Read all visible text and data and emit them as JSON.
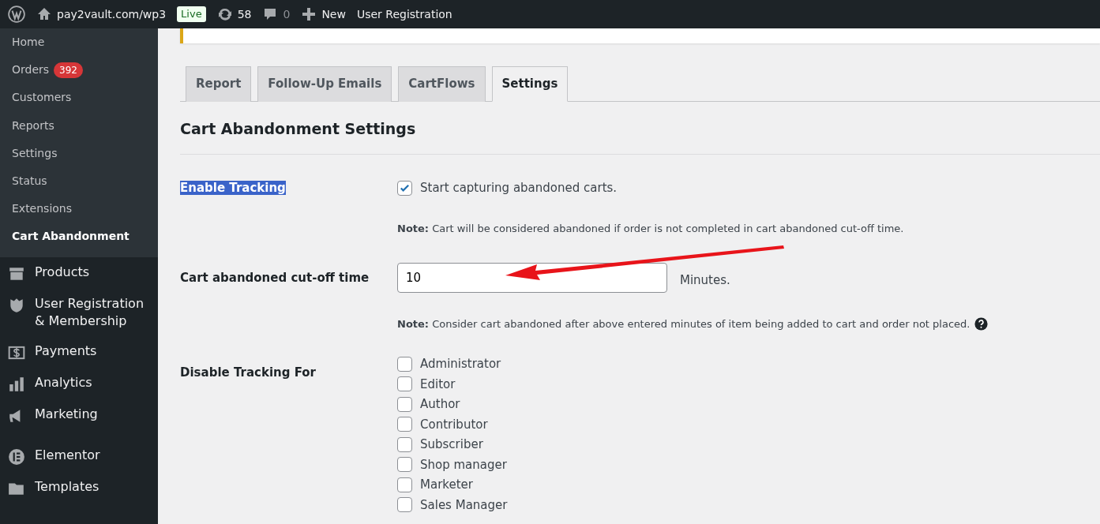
{
  "admin_bar": {
    "site": "pay2vault.com/wp3",
    "badge": "Live",
    "updates": "58",
    "comments": "0",
    "new": "New",
    "extra": "User Registration"
  },
  "sidebar": {
    "submenu": [
      {
        "label": "Home",
        "selected": false
      },
      {
        "label": "Orders",
        "badge": "392",
        "selected": false
      },
      {
        "label": "Customers",
        "selected": false
      },
      {
        "label": "Reports",
        "selected": false
      },
      {
        "label": "Settings",
        "selected": false
      },
      {
        "label": "Status",
        "selected": false
      },
      {
        "label": "Extensions",
        "selected": false
      },
      {
        "label": "Cart Abandonment",
        "selected": true
      }
    ],
    "menu": [
      {
        "label": "Products"
      },
      {
        "label": "User Registration & Membership"
      },
      {
        "label": "Payments"
      },
      {
        "label": "Analytics"
      },
      {
        "label": "Marketing"
      },
      {
        "label": "Elementor"
      },
      {
        "label": "Templates"
      }
    ]
  },
  "tabs": [
    {
      "label": "Report",
      "selected": false
    },
    {
      "label": "Follow-Up Emails",
      "selected": false
    },
    {
      "label": "CartFlows",
      "selected": false
    },
    {
      "label": "Settings",
      "selected": true
    }
  ],
  "settings": {
    "title": "Cart Abandonment Settings",
    "fields": [
      {
        "kind": "checkbox",
        "label": "Enable Tracking",
        "label_highlighted": true,
        "option": "Start capturing abandoned carts.",
        "checked": true,
        "note": "**Note:** Cart will be considered abandoned if order is not completed in cart abandoned cut-off time."
      },
      {
        "kind": "number",
        "label": "Cart abandoned cut-off time",
        "value": "10",
        "unit": "Minutes.",
        "note": "**Note:** Consider cart abandoned after above entered minutes of item being added to cart and order not placed."
      },
      {
        "kind": "checklist",
        "label": "Disable Tracking For",
        "options": [
          {
            "label": "Administrator",
            "checked": false
          },
          {
            "label": "Editor",
            "checked": false
          },
          {
            "label": "Author",
            "checked": false
          },
          {
            "label": "Contributor",
            "checked": false
          },
          {
            "label": "Subscriber",
            "checked": false
          },
          {
            "label": "Shop manager",
            "checked": false
          },
          {
            "label": "Marketer",
            "checked": false
          },
          {
            "label": "Sales Manager",
            "checked": false
          }
        ]
      }
    ]
  }
}
